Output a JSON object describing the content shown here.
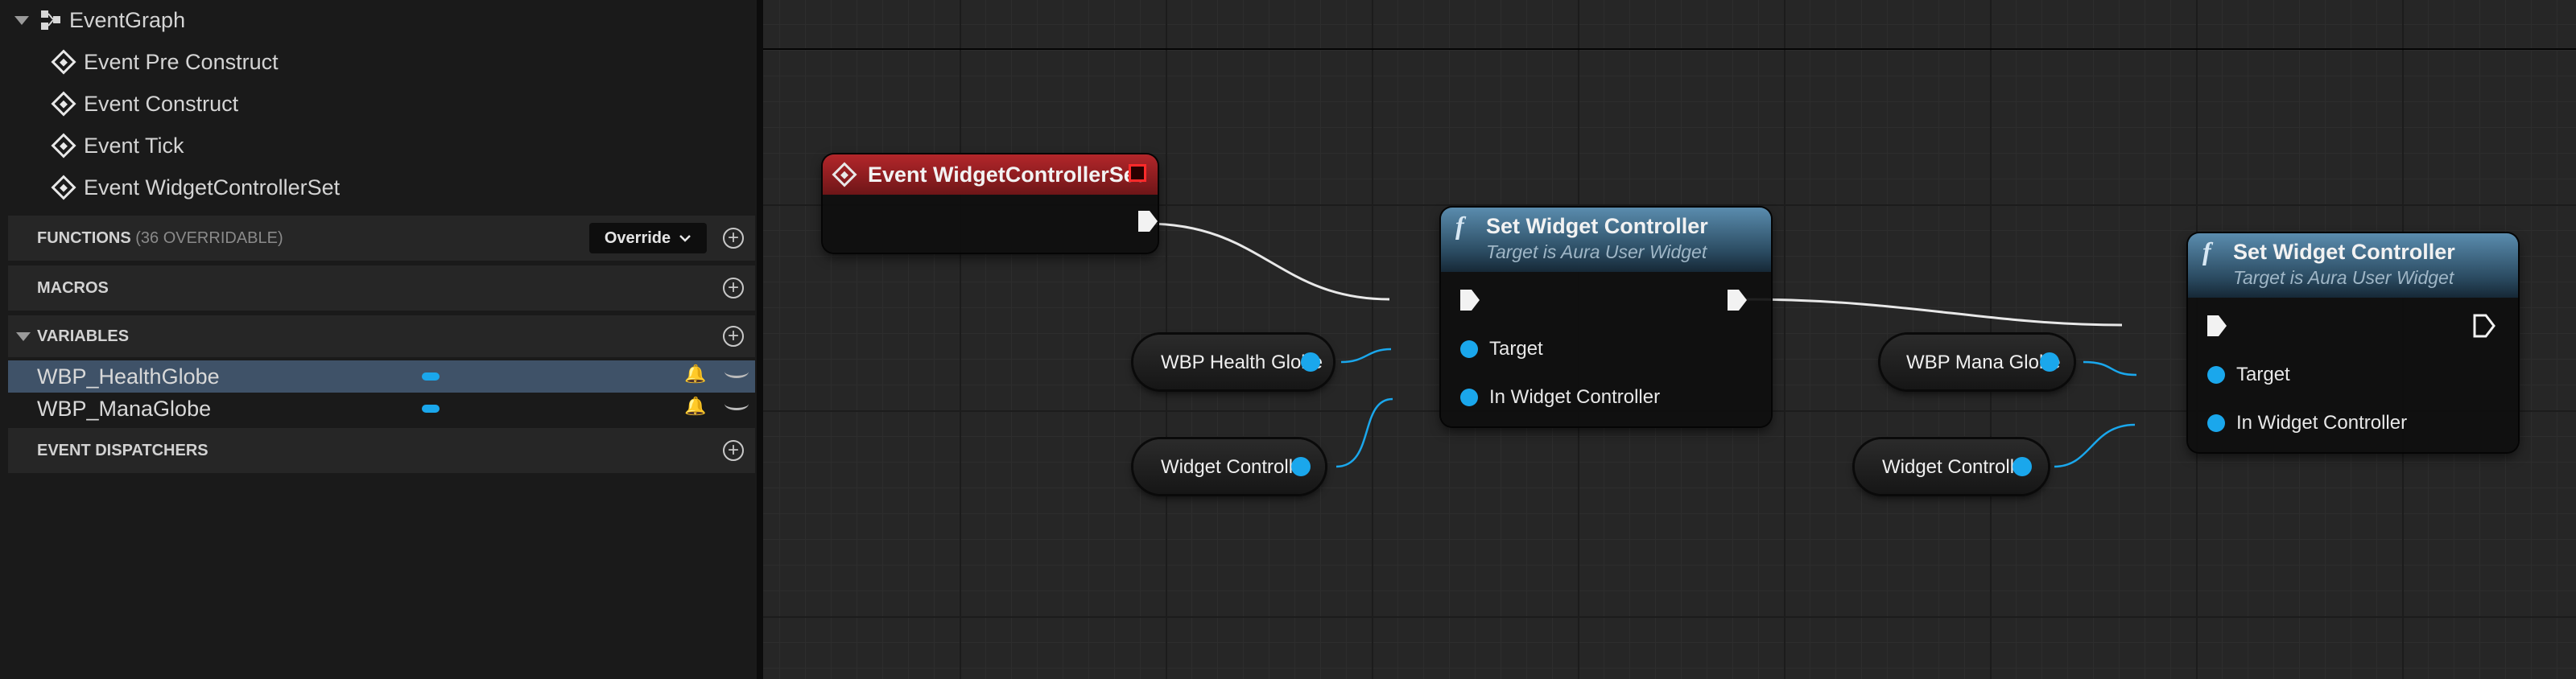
{
  "sidebar": {
    "graph": {
      "label": "EventGraph"
    },
    "events": [
      {
        "label": "Event Pre Construct"
      },
      {
        "label": "Event Construct"
      },
      {
        "label": "Event Tick"
      },
      {
        "label": "Event WidgetControllerSet"
      }
    ],
    "functions": {
      "label": "FUNCTIONS",
      "sub": "(36 OVERRIDABLE)",
      "override": "Override"
    },
    "macros": {
      "label": "MACROS"
    },
    "variables": {
      "label": "VARIABLES",
      "items": [
        {
          "name": "WBP_HealthGlobe",
          "selected": true
        },
        {
          "name": "WBP_ManaGlobe",
          "selected": false
        }
      ]
    },
    "dispatchers": {
      "label": "EVENT DISPATCHERS"
    }
  },
  "graph": {
    "event_node": {
      "title": "Event WidgetControllerSet"
    },
    "set_nodes": [
      {
        "title": "Set Widget Controller",
        "subtitle": "Target is Aura User Widget",
        "pin_target": "Target",
        "pin_controller": "In Widget Controller"
      },
      {
        "title": "Set Widget Controller",
        "subtitle": "Target is Aura User Widget",
        "pin_target": "Target",
        "pin_controller": "In Widget Controller"
      }
    ],
    "var_nodes": [
      {
        "label": "WBP Health Globe"
      },
      {
        "label": "Widget Controller"
      },
      {
        "label": "WBP Mana Globe"
      },
      {
        "label": "Widget Controller"
      }
    ],
    "colors": {
      "object_pin": "#1aa7ec",
      "event_header": "#a0272a",
      "function_header": "#4a7896"
    }
  }
}
